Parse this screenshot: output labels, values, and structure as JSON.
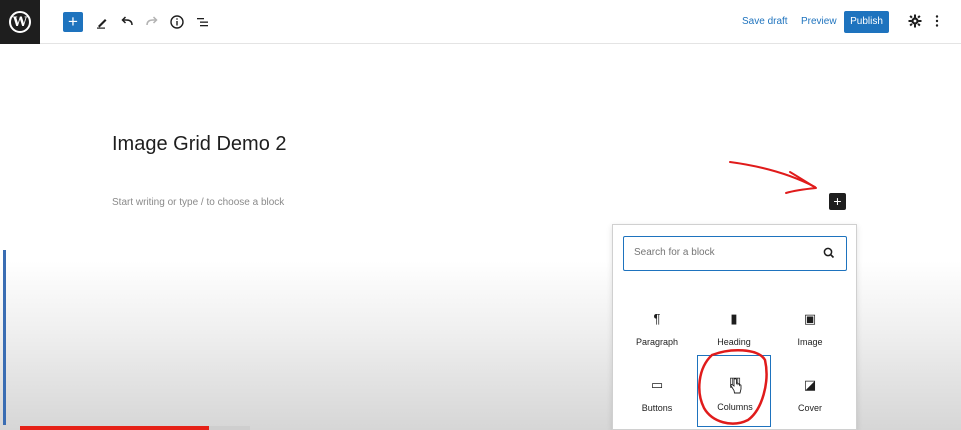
{
  "toolbar": {
    "logo": "W",
    "add_block": "+",
    "tools_icon": "pencil-icon",
    "undo_icon": "undo-icon",
    "redo_icon": "redo-icon",
    "details_icon": "info-icon",
    "list_view_icon": "list-view-icon",
    "save_draft": "Save draft",
    "preview": "Preview",
    "publish": "Publish",
    "settings_icon": "gear-icon",
    "more_icon": "more-vertical-icon"
  },
  "editor": {
    "title": "Image Grid Demo 2",
    "placeholder": "Start writing or type / to choose a block",
    "add_block": "+"
  },
  "inserter": {
    "search_placeholder": "Search for a block",
    "blocks": [
      {
        "label": "Paragraph",
        "icon": "¶",
        "icon_name": "paragraph-icon"
      },
      {
        "label": "Heading",
        "icon": "▮",
        "icon_name": "heading-bookmark-icon"
      },
      {
        "label": "Image",
        "icon": "▣",
        "icon_name": "image-icon"
      },
      {
        "label": "Buttons",
        "icon": "▭",
        "icon_name": "buttons-icon"
      },
      {
        "label": "Columns",
        "icon": "▥",
        "icon_name": "columns-icon"
      },
      {
        "label": "Cover",
        "icon": "◪",
        "icon_name": "cover-icon"
      }
    ]
  },
  "colors": {
    "accent": "#1e73be",
    "annotation": "#e01b1b",
    "video_progress": "#e62117"
  },
  "video": {
    "progress": 0.82
  }
}
